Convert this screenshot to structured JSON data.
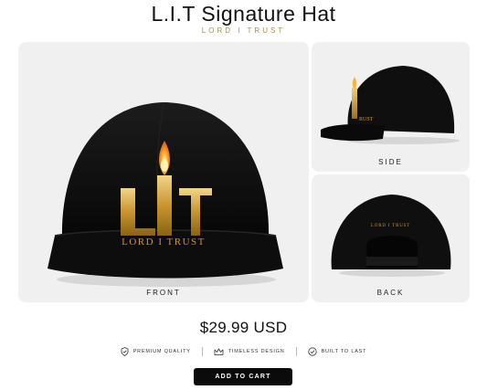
{
  "product": {
    "title": "L.I.T Signature Hat",
    "subtitle": "LORD I TRUST",
    "price": "$29.99 USD"
  },
  "gallery": {
    "front": {
      "label": "FRONT",
      "logo_letters": "L  T",
      "logo_text": "LORD I TRUST"
    },
    "side": {
      "label": "SIDE"
    },
    "back": {
      "label": "BACK",
      "embroidery": "LORD I TRUST"
    }
  },
  "features": [
    {
      "icon": "shield-check-icon",
      "label": "PREMIUM QUALITY"
    },
    {
      "icon": "crown-icon",
      "label": "TIMELESS DESIGN"
    },
    {
      "icon": "check-circle-icon",
      "label": "BUILT TO LAST"
    }
  ],
  "actions": {
    "add_to_cart": "ADD TO CART"
  },
  "colors": {
    "accent_gold": "#b58f3c",
    "button": "#0b0b0b",
    "panel": "#f0f0f0"
  }
}
